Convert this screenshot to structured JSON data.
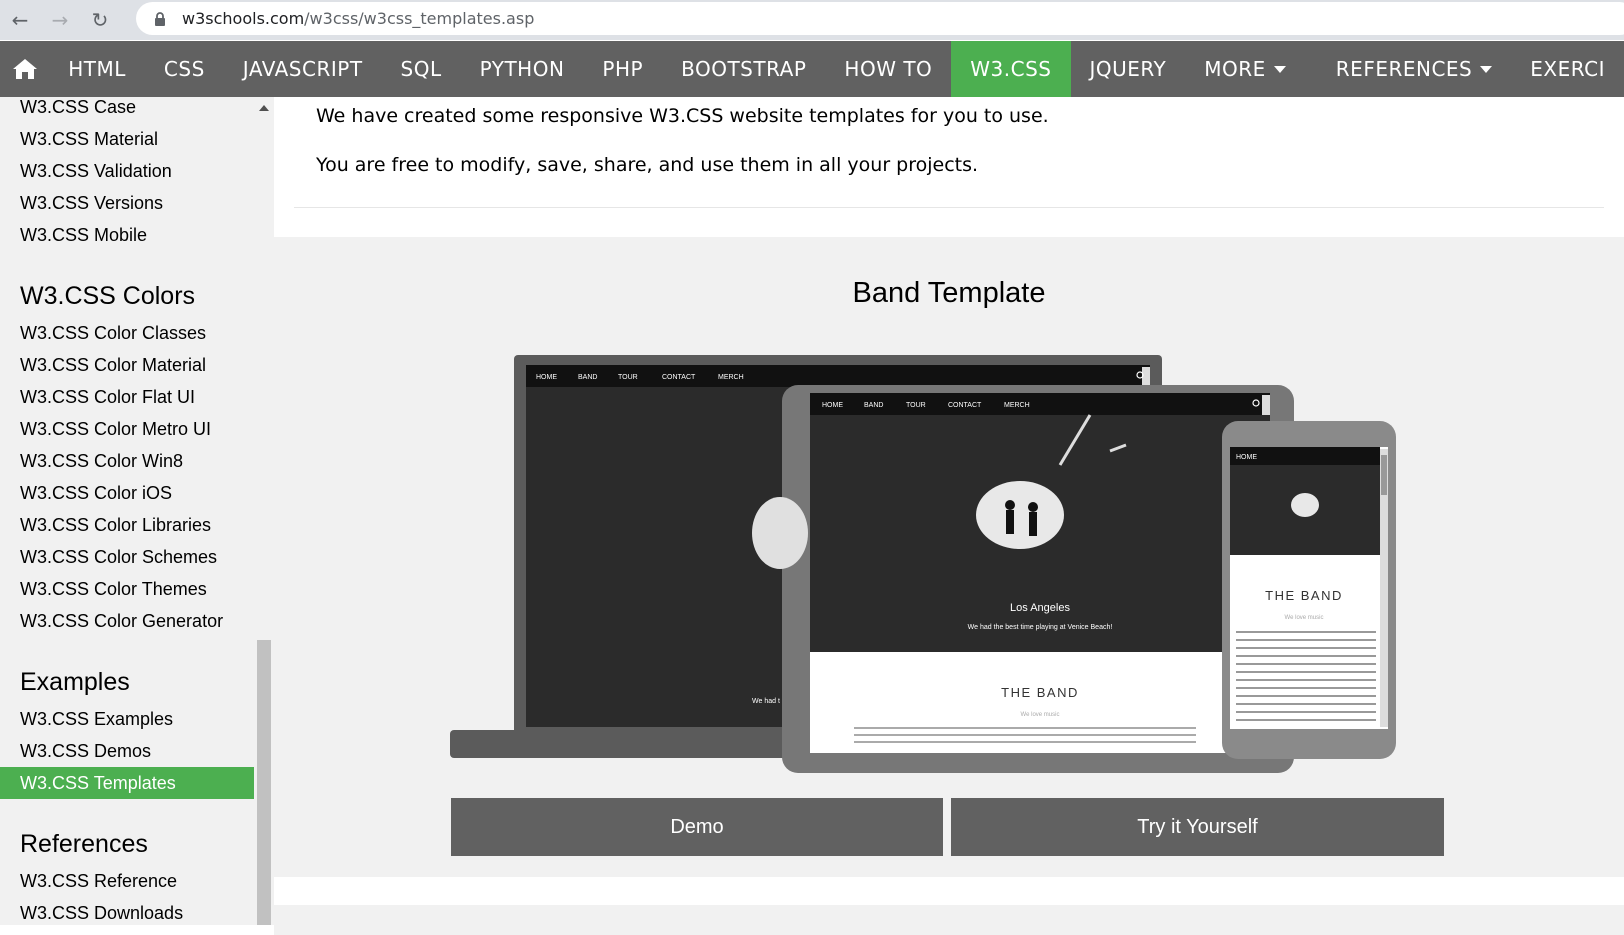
{
  "browser": {
    "url_host": "w3schools.com",
    "url_path": "/w3css/w3css_templates.asp"
  },
  "topnav": {
    "items": [
      {
        "label": "HTML"
      },
      {
        "label": "CSS"
      },
      {
        "label": "JAVASCRIPT"
      },
      {
        "label": "SQL"
      },
      {
        "label": "PYTHON"
      },
      {
        "label": "PHP"
      },
      {
        "label": "BOOTSTRAP"
      },
      {
        "label": "HOW TO"
      },
      {
        "label": "W3.CSS"
      },
      {
        "label": "JQUERY"
      },
      {
        "label": "MORE"
      },
      {
        "label": "REFERENCES"
      },
      {
        "label": "EXERCI"
      }
    ],
    "active_color": "#4caf50",
    "bg_color": "#616161"
  },
  "sidebar": {
    "top_links": [
      "W3.CSS Case",
      "W3.CSS Material",
      "W3.CSS Validation",
      "W3.CSS Versions",
      "W3.CSS Mobile"
    ],
    "colors_heading": "W3.CSS Colors",
    "colors_links": [
      "W3.CSS Color Classes",
      "W3.CSS Color Material",
      "W3.CSS Color Flat UI",
      "W3.CSS Color Metro UI",
      "W3.CSS Color Win8",
      "W3.CSS Color iOS",
      "W3.CSS Color Libraries",
      "W3.CSS Color Schemes",
      "W3.CSS Color Themes",
      "W3.CSS Color Generator"
    ],
    "examples_heading": "Examples",
    "examples_links": [
      "W3.CSS Examples",
      "W3.CSS Demos",
      "W3.CSS Templates"
    ],
    "references_heading": "References",
    "references_links": [
      "W3.CSS Reference",
      "W3.CSS Downloads"
    ]
  },
  "main": {
    "intro1": "We have created some responsive W3.CSS website templates for you to use.",
    "intro2": "You are free to modify, save, share, and use them in all your projects.",
    "template_title": "Band Template",
    "demo_label": "Demo",
    "try_label": "Try it Yourself"
  },
  "preview": {
    "nav": [
      "HOME",
      "BAND",
      "TOUR",
      "CONTACT",
      "MERCH"
    ],
    "mobile_nav": "HOME",
    "city": "Los Angeles",
    "caption": "We had the best time playing at Venice Beach!",
    "caption_partial": "We had t",
    "band_title": "THE BAND",
    "band_sub": "We love music"
  }
}
